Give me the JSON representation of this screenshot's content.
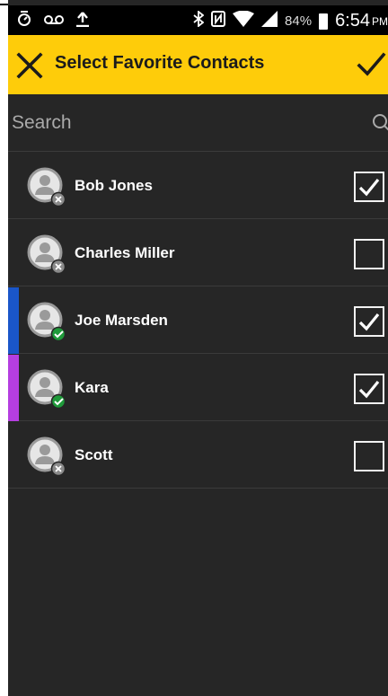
{
  "status_bar": {
    "left_icons": [
      "alarm-icon",
      "voicemail-icon",
      "upload-icon"
    ],
    "right_icons": [
      "bluetooth-icon",
      "nfc-icon",
      "wifi-icon",
      "signal-icon"
    ],
    "battery": "84%",
    "time": "6:54",
    "ampm": "PM"
  },
  "appbar": {
    "title": "Select Favorite Contacts",
    "close_icon": "close-icon",
    "confirm_icon": "checkmark-icon",
    "color": "#fecc0a"
  },
  "search": {
    "placeholder": "Search",
    "value": ""
  },
  "contacts": [
    {
      "name": "Bob Jones",
      "checked": true,
      "status": "offline",
      "accent": ""
    },
    {
      "name": "Charles Miller",
      "checked": false,
      "status": "offline",
      "accent": ""
    },
    {
      "name": "Joe Marsden",
      "checked": true,
      "status": "online",
      "accent": "#1a56c9"
    },
    {
      "name": "Kara",
      "checked": true,
      "status": "online",
      "accent": "#b53ee0"
    },
    {
      "name": "Scott",
      "checked": false,
      "status": "offline",
      "accent": ""
    }
  ]
}
